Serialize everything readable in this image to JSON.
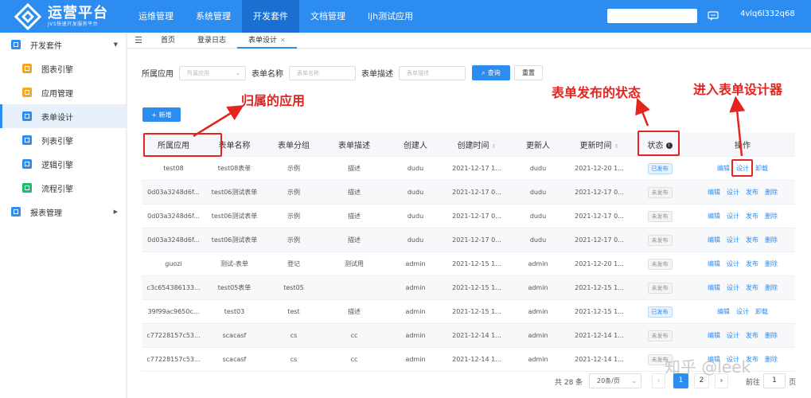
{
  "brand": {
    "title": "运营平台",
    "subtitle": "JVS快速开发服务平台"
  },
  "topnav": [
    "运维管理",
    "系统管理",
    "开发套件",
    "文档管理",
    "ljh测试应用"
  ],
  "topnav_active": 2,
  "user": "4vlq6l332q68",
  "sidebar": {
    "group1": "开发套件",
    "items": [
      "图表引擎",
      "应用管理",
      "表单设计",
      "列表引擎",
      "逻辑引擎",
      "流程引擎"
    ],
    "group2": "报表管理"
  },
  "tabs": [
    "首页",
    "登录日志",
    "表单设计"
  ],
  "filters": {
    "app_label": "所属应用",
    "app_placeholder": "所属应用",
    "name_label": "表单名称",
    "name_placeholder": "表单名称",
    "desc_label": "表单描述",
    "desc_placeholder": "表单描述",
    "query": "查询",
    "reset": "重置"
  },
  "add_button": "+ 新增",
  "table": {
    "headers": [
      "所属应用",
      "表单名称",
      "表单分组",
      "表单描述",
      "创建人",
      "创建时间",
      "更新人",
      "更新时间",
      "状态",
      "操作"
    ],
    "rows": [
      {
        "app": "test08",
        "name": "test08表单",
        "group": "示例",
        "desc": "描述",
        "creator": "dudu",
        "created": "2021-12-17 1...",
        "updater": "dudu",
        "updated": "2021-12-20 1...",
        "status": "已发布",
        "ops": [
          "编辑",
          "设计",
          "卸载"
        ]
      },
      {
        "app": "0d03a3248d6f...",
        "name": "test06测试表单",
        "group": "示例",
        "desc": "描述",
        "creator": "dudu",
        "created": "2021-12-17 0...",
        "updater": "dudu",
        "updated": "2021-12-17 0...",
        "status": "未发布",
        "ops": [
          "编辑",
          "设计",
          "发布",
          "删除"
        ]
      },
      {
        "app": "0d03a3248d6f...",
        "name": "test06测试表单",
        "group": "示例",
        "desc": "描述",
        "creator": "dudu",
        "created": "2021-12-17 0...",
        "updater": "dudu",
        "updated": "2021-12-17 0...",
        "status": "未发布",
        "ops": [
          "编辑",
          "设计",
          "发布",
          "删除"
        ]
      },
      {
        "app": "0d03a3248d6f...",
        "name": "test06测试表单",
        "group": "示例",
        "desc": "描述",
        "creator": "dudu",
        "created": "2021-12-17 0...",
        "updater": "dudu",
        "updated": "2021-12-17 0...",
        "status": "未发布",
        "ops": [
          "编辑",
          "设计",
          "发布",
          "删除"
        ]
      },
      {
        "app": "guozi",
        "name": "测试-表单",
        "group": "登记",
        "desc": "测试用",
        "creator": "admin",
        "created": "2021-12-15 1...",
        "updater": "admin",
        "updated": "2021-12-20 1...",
        "status": "未发布",
        "ops": [
          "编辑",
          "设计",
          "发布",
          "删除"
        ]
      },
      {
        "app": "c3c654386133...",
        "name": "test05表单",
        "group": "test05",
        "desc": "",
        "creator": "admin",
        "created": "2021-12-15 1...",
        "updater": "admin",
        "updated": "2021-12-15 1...",
        "status": "未发布",
        "ops": [
          "编辑",
          "设计",
          "发布",
          "删除"
        ]
      },
      {
        "app": "39f99ac9650c...",
        "name": "test03",
        "group": "test",
        "desc": "描述",
        "creator": "admin",
        "created": "2021-12-15 1...",
        "updater": "admin",
        "updated": "2021-12-15 1...",
        "status": "已发布",
        "ops": [
          "编辑",
          "设计",
          "卸载"
        ]
      },
      {
        "app": "c77228157c53...",
        "name": "scacasf",
        "group": "cs",
        "desc": "cc",
        "creator": "admin",
        "created": "2021-12-14 1...",
        "updater": "admin",
        "updated": "2021-12-14 1...",
        "status": "未发布",
        "ops": [
          "编辑",
          "设计",
          "发布",
          "删除"
        ]
      },
      {
        "app": "c77228157c53...",
        "name": "scacasf",
        "group": "cs",
        "desc": "cc",
        "creator": "admin",
        "created": "2021-12-14 1...",
        "updater": "admin",
        "updated": "2021-12-14 1...",
        "status": "未发布",
        "ops": [
          "编辑",
          "设计",
          "发布",
          "删除"
        ]
      }
    ]
  },
  "pager": {
    "total": "共 28 条",
    "page_size": "20条/页",
    "pages": [
      "1",
      "2"
    ],
    "goto_label": "前往",
    "goto_value": "1",
    "goto_suffix": "页"
  },
  "annotations": {
    "app": "归属的应用",
    "status": "表单发布的状态",
    "design": "进入表单设计器"
  },
  "watermark": "知乎 @leek",
  "colors": {
    "primary": "#2d8cf0",
    "annotation": "#e5231f"
  }
}
